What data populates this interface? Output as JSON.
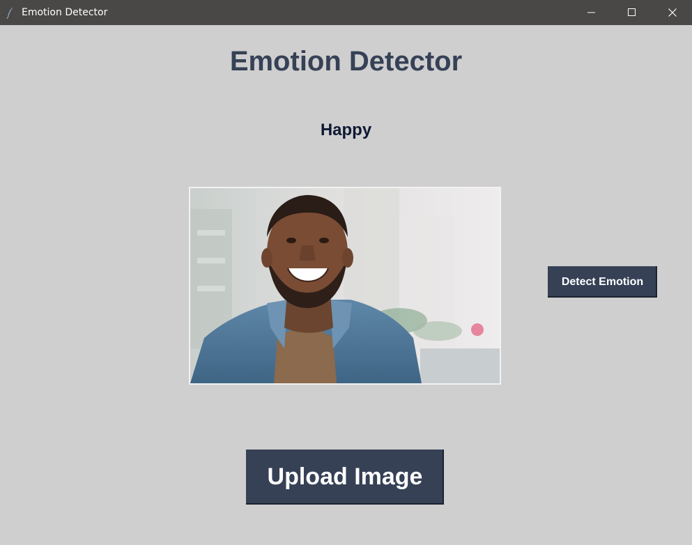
{
  "window": {
    "title": "Emotion Detector",
    "icon": "feather-icon",
    "controls": [
      "minimize-icon",
      "maximize-icon",
      "close-icon"
    ]
  },
  "app": {
    "heading": "Emotion Detector",
    "result": "Happy",
    "image": "photo of smiling bearded man in denim jacket on a city street",
    "detect_label": "Detect Emotion",
    "upload_label": "Upload Image"
  },
  "colors": {
    "background": "#cfcfcf",
    "titlebar": "#4a4847",
    "heading": "#364156",
    "button": "#364156",
    "button_text": "#ffffff"
  }
}
